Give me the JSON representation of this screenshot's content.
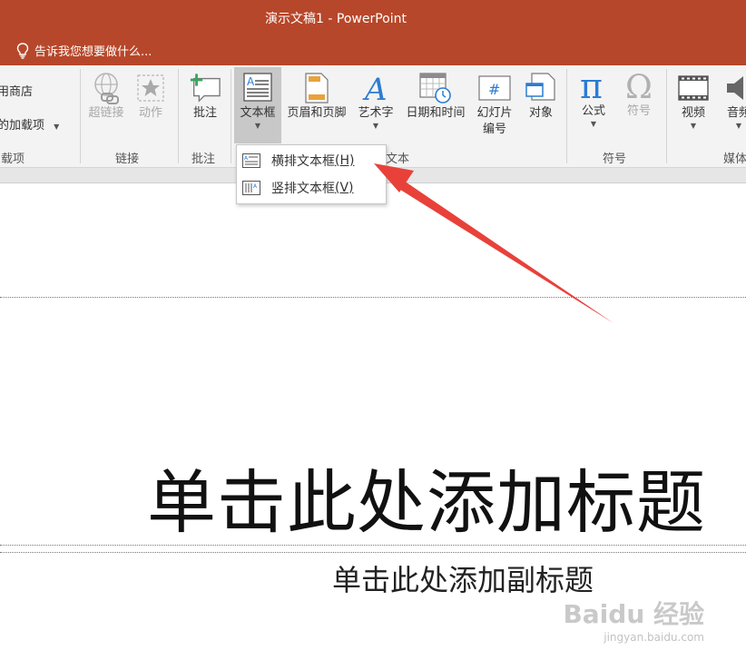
{
  "window": {
    "title": "演示文稿1 - PowerPoint"
  },
  "tell_me": {
    "placeholder": "告诉我您想要做什么..."
  },
  "ribbon": {
    "addins": {
      "store_label": "应用商店",
      "my_addins_label": "我的加载项",
      "group_label": "加载项"
    },
    "links": {
      "hyperlink_label": "超链接",
      "action_label": "动作",
      "group_label": "链接"
    },
    "comments": {
      "comment_label": "批注",
      "group_label": "批注"
    },
    "text": {
      "textbox_label": "文本框",
      "header_footer_label": "页眉和页脚",
      "wordart_label": "艺术字",
      "datetime_label": "日期和时间",
      "slide_number_label_line1": "幻灯片",
      "slide_number_label_line2": "编号",
      "object_label": "对象",
      "group_label": "文本"
    },
    "symbols": {
      "equation_label": "公式",
      "symbol_label": "符号",
      "group_label": "符号"
    },
    "media": {
      "video_label": "视频",
      "audio_label": "音频",
      "group_label": "媒体"
    }
  },
  "dropdown": {
    "items": [
      {
        "label": "横排文本框",
        "key": "(H)"
      },
      {
        "label": "竖排文本框",
        "key": "(V)"
      }
    ]
  },
  "slide": {
    "title_placeholder": "单击此处添加标题",
    "subtitle_placeholder": "单击此处添加副标题"
  },
  "watermark": {
    "logo": "Baidu 经验",
    "url": "jingyan.baidu.com"
  },
  "colors": {
    "title_bar": "#b7472a",
    "ribbon_bg": "#f3f3f3",
    "arrow": "#e8413a",
    "accent_blue": "#2b7cd3"
  }
}
